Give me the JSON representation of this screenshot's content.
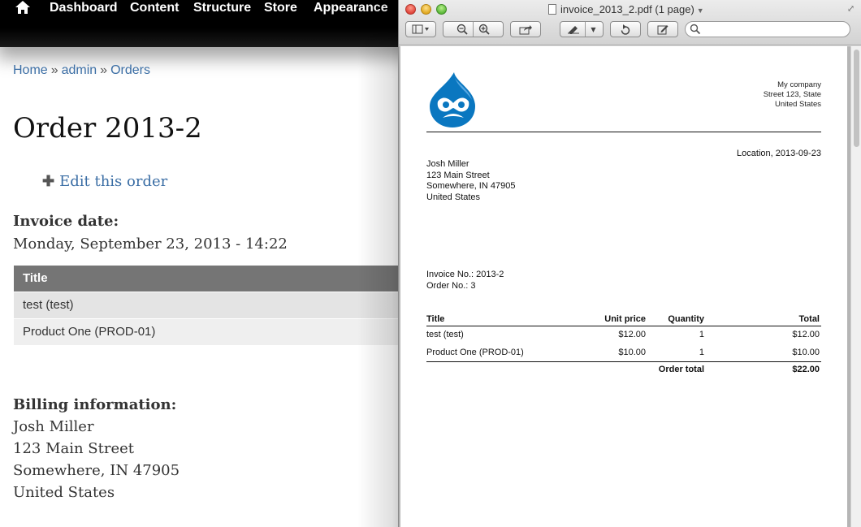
{
  "toolbar": {
    "items": [
      "Dashboard",
      "Content",
      "Structure",
      "Store",
      "Appearance"
    ]
  },
  "breadcrumb": {
    "items": [
      "Home",
      "admin",
      "Orders"
    ],
    "separator": "»"
  },
  "page": {
    "title": "Order 2013-2",
    "edit_link": "Edit this order",
    "invoice_date_label": "Invoice date:",
    "invoice_date": "Monday, September 23, 2013 - 14:22",
    "table_header": "Title",
    "rows": [
      "test (test)",
      "Product One (PROD-01)"
    ],
    "billing_label": "Billing information:",
    "billing": [
      "Josh Miller",
      "123 Main Street",
      "Somewhere, IN 47905",
      "United States"
    ]
  },
  "preview": {
    "window_title": "invoice_2013_2.pdf (1 page)",
    "search_placeholder": "",
    "pdf": {
      "company": [
        "My company",
        "Street 123, State",
        "United States"
      ],
      "location_date": "Location, 2013-09-23",
      "customer": [
        "Josh Miller",
        "123 Main Street",
        "Somewhere, IN 47905",
        "United States"
      ],
      "invoice_no": "Invoice No.: 2013-2",
      "order_no": "Order No.: 3",
      "columns": [
        "Title",
        "Unit price",
        "Quantity",
        "Total"
      ],
      "lines": [
        {
          "title": "test (test)",
          "unit_price": "$12.00",
          "quantity": "1",
          "total": "$12.00"
        },
        {
          "title": "Product One (PROD-01)",
          "unit_price": "$10.00",
          "quantity": "1",
          "total": "$10.00"
        }
      ],
      "order_total_label": "Order total",
      "order_total": "$22.00"
    }
  },
  "colors": {
    "link": "#3b6ea5",
    "table_header": "#757575",
    "drupal_blue": "#0a77c0"
  }
}
